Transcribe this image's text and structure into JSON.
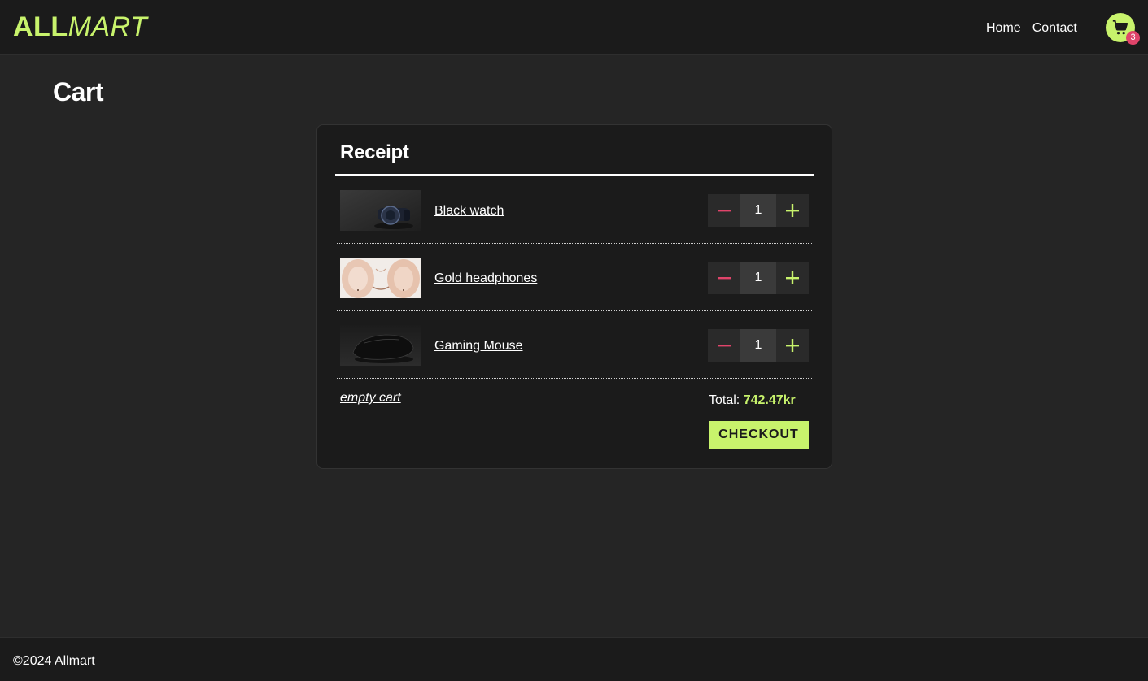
{
  "brand": {
    "part1": "ALL",
    "part2": "MART",
    "accent_color": "#c8f36c"
  },
  "nav": {
    "home": "Home",
    "contact": "Contact"
  },
  "cart_icon": {
    "icon": "cart-icon",
    "badge_count": "3",
    "badge_color": "#e0446a"
  },
  "page": {
    "title": "Cart"
  },
  "receipt": {
    "title": "Receipt",
    "items": [
      {
        "name": "Black watch",
        "quantity": "1",
        "image": "black-watch-image"
      },
      {
        "name": "Gold headphones",
        "quantity": "1",
        "image": "gold-headphones-image"
      },
      {
        "name": "Gaming Mouse",
        "quantity": "1",
        "image": "gaming-mouse-image"
      }
    ],
    "empty_cart_label": "empty cart",
    "total_label": "Total:",
    "total_value": "742.47kr",
    "checkout_label": "CHECKOUT",
    "minus_icon": "minus-icon",
    "plus_icon": "plus-icon"
  },
  "footer": {
    "copyright": "©2024 Allmart"
  }
}
